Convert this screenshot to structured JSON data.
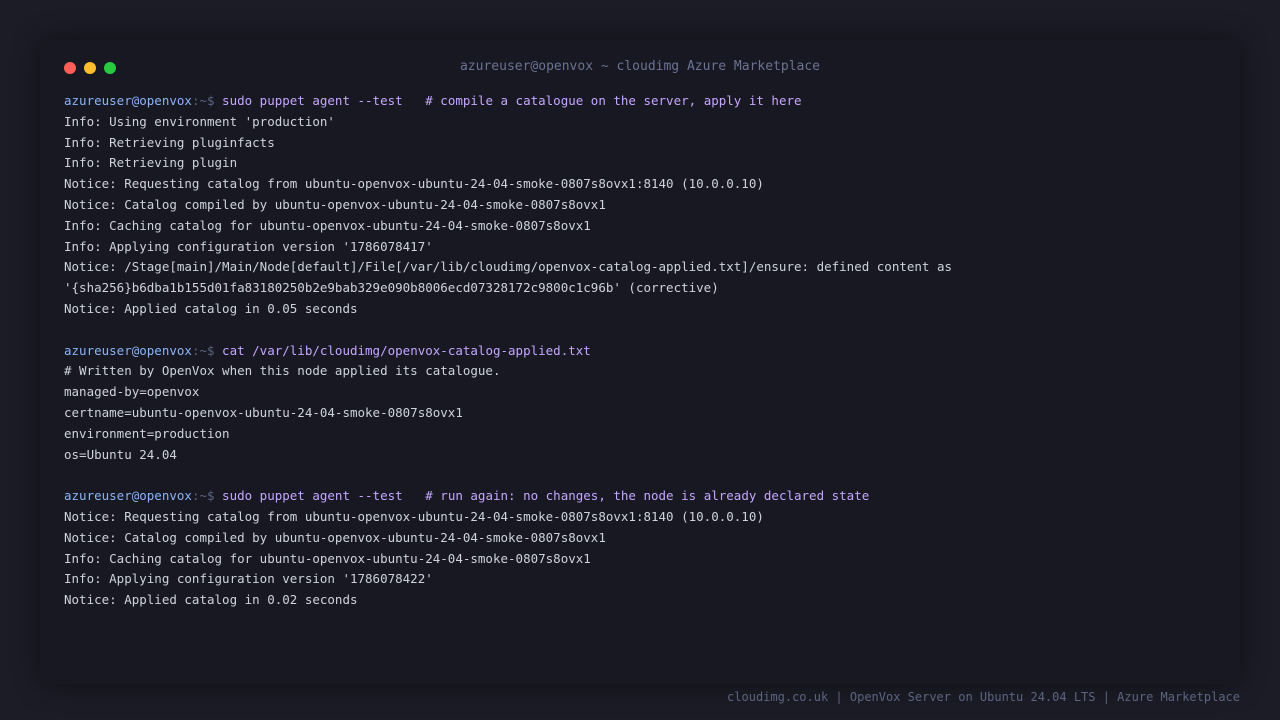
{
  "window": {
    "title": "azureuser@openvox ~ cloudimg Azure Marketplace",
    "controls": [
      "close",
      "minimize",
      "maximize"
    ]
  },
  "prompt": {
    "user_host": "azureuser@openvox",
    "path_symbol": ":~$ "
  },
  "blocks": [
    {
      "command": "sudo puppet agent --test   # compile a catalogue on the server, apply it here",
      "output": [
        "Info: Using environment 'production'",
        "Info: Retrieving pluginfacts",
        "Info: Retrieving plugin",
        "Notice: Requesting catalog from ubuntu-openvox-ubuntu-24-04-smoke-0807s8ovx1:8140 (10.0.0.10)",
        "Notice: Catalog compiled by ubuntu-openvox-ubuntu-24-04-smoke-0807s8ovx1",
        "Info: Caching catalog for ubuntu-openvox-ubuntu-24-04-smoke-0807s8ovx1",
        "Info: Applying configuration version '1786078417'",
        "Notice: /Stage[main]/Main/Node[default]/File[/var/lib/cloudimg/openvox-catalog-applied.txt]/ensure: defined content as",
        "'{sha256}b6dba1b155d01fa83180250b2e9bab329e090b8006ecd07328172c9800c1c96b' (corrective)",
        "Notice: Applied catalog in 0.05 seconds"
      ]
    },
    {
      "command": "cat /var/lib/cloudimg/openvox-catalog-applied.txt",
      "output": [
        "# Written by OpenVox when this node applied its catalogue.",
        "managed-by=openvox",
        "certname=ubuntu-openvox-ubuntu-24-04-smoke-0807s8ovx1",
        "environment=production",
        "os=Ubuntu 24.04"
      ]
    },
    {
      "command": "sudo puppet agent --test   # run again: no changes, the node is already declared state",
      "output": [
        "Notice: Requesting catalog from ubuntu-openvox-ubuntu-24-04-smoke-0807s8ovx1:8140 (10.0.0.10)",
        "Notice: Catalog compiled by ubuntu-openvox-ubuntu-24-04-smoke-0807s8ovx1",
        "Info: Caching catalog for ubuntu-openvox-ubuntu-24-04-smoke-0807s8ovx1",
        "Info: Applying configuration version '1786078422'",
        "Notice: Applied catalog in 0.02 seconds"
      ]
    }
  ],
  "footer": {
    "text": "cloudimg.co.uk | OpenVox Server on Ubuntu 24.04 LTS | Azure Marketplace"
  },
  "colors": {
    "background": "#1b1c26",
    "window": "#171821",
    "text": "#cfd2dc",
    "user": "#8ab4f8",
    "command": "#c5a6ff",
    "muted": "#5d6480"
  }
}
